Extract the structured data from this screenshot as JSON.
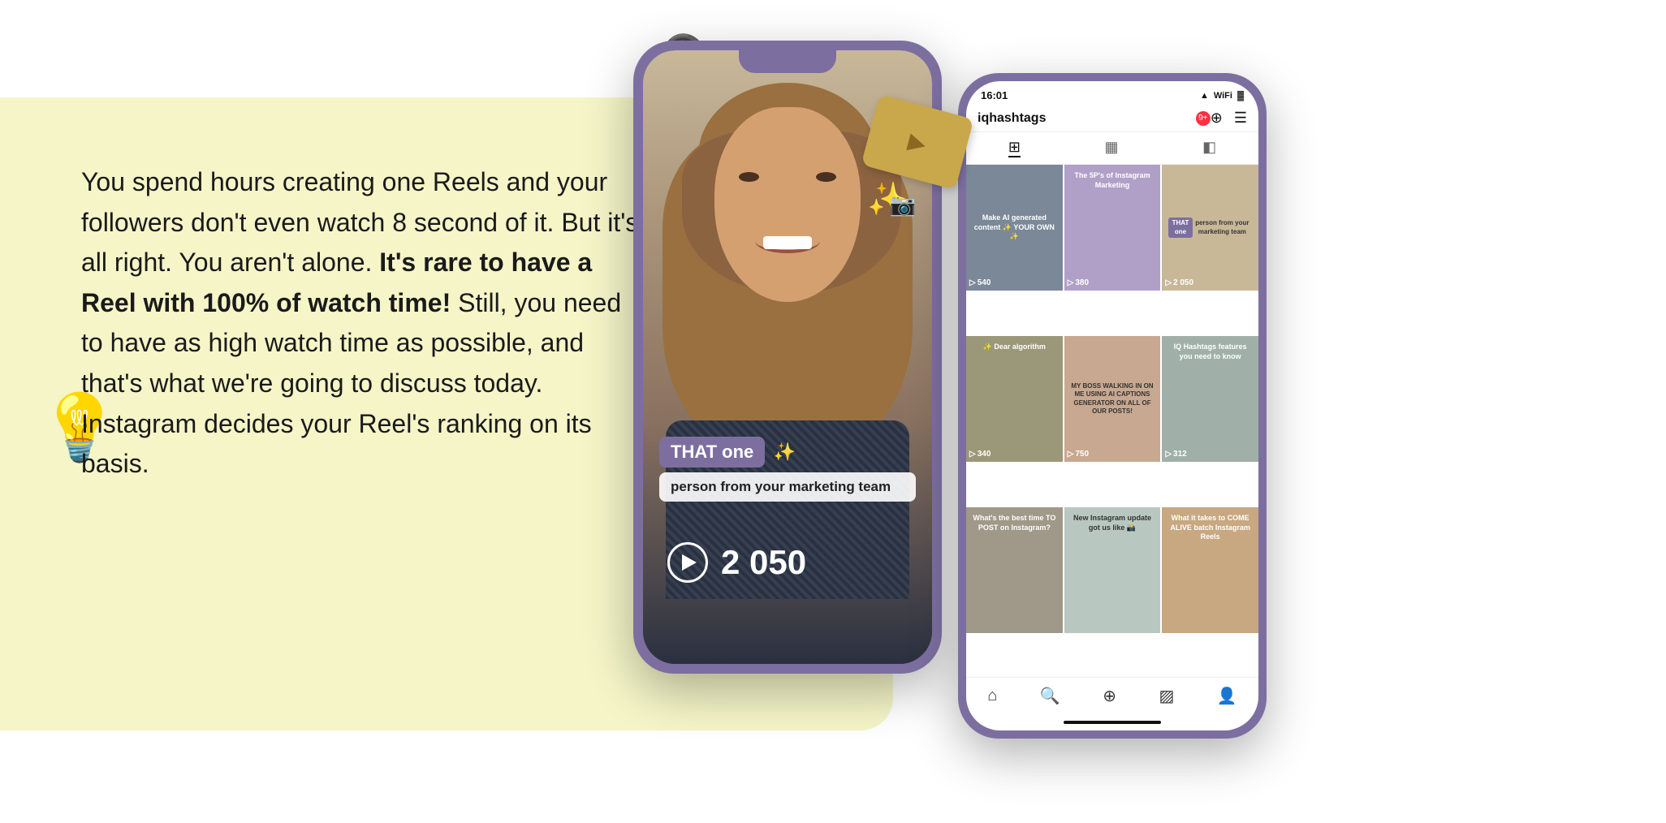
{
  "background": {
    "color": "#f5f5c8"
  },
  "main_text": {
    "part1": "You spend hours creating one Reels and your followers don't even watch 8 second of it. But it's all right. You aren't alone. ",
    "part2": "It's rare to have a Reel with 100% of watch time!",
    "part3": " Still, you need to have as high watch time as possible, and that's  what we're going to discuss today. Instagram decides your Reel's ranking on its basis."
  },
  "phone1": {
    "caption": {
      "highlight": "THAT one",
      "subtitle": "person from your marketing team"
    },
    "play_count": "2 050",
    "sticker_label": "▶"
  },
  "phone2": {
    "status_time": "16:01",
    "username": "iqhashtags",
    "notification_count": "9+",
    "grid": [
      {
        "id": 1,
        "text": "Make AI generated content ✨ YOUR OWN ✨",
        "count": "540"
      },
      {
        "id": 2,
        "text": "The 5P's of Instagram Marketing",
        "count": "380"
      },
      {
        "id": 3,
        "text": "THAT one person from your marketing team",
        "count": "2 050"
      },
      {
        "id": 4,
        "text": "Dear algorithm",
        "count": "340"
      },
      {
        "id": 5,
        "text": "MY BOSS WALKING IN ON ME USING AI CAPTIONS GENERATOR ON ALL OF OUR POSTS",
        "count": "750"
      },
      {
        "id": 6,
        "text": "IQ Hashtags features you need to know",
        "count": "312"
      },
      {
        "id": 7,
        "text": "What's the best time TO POST on Instagram?",
        "count": ""
      },
      {
        "id": 8,
        "text": "New Instagram update got us like",
        "count": ""
      },
      {
        "id": 9,
        "text": "What it takes to COME ALIVE batch Instagram Reels",
        "count": ""
      }
    ]
  },
  "icons": {
    "bulb": "💡",
    "sparkle": "✨",
    "headphones": "🎧"
  }
}
